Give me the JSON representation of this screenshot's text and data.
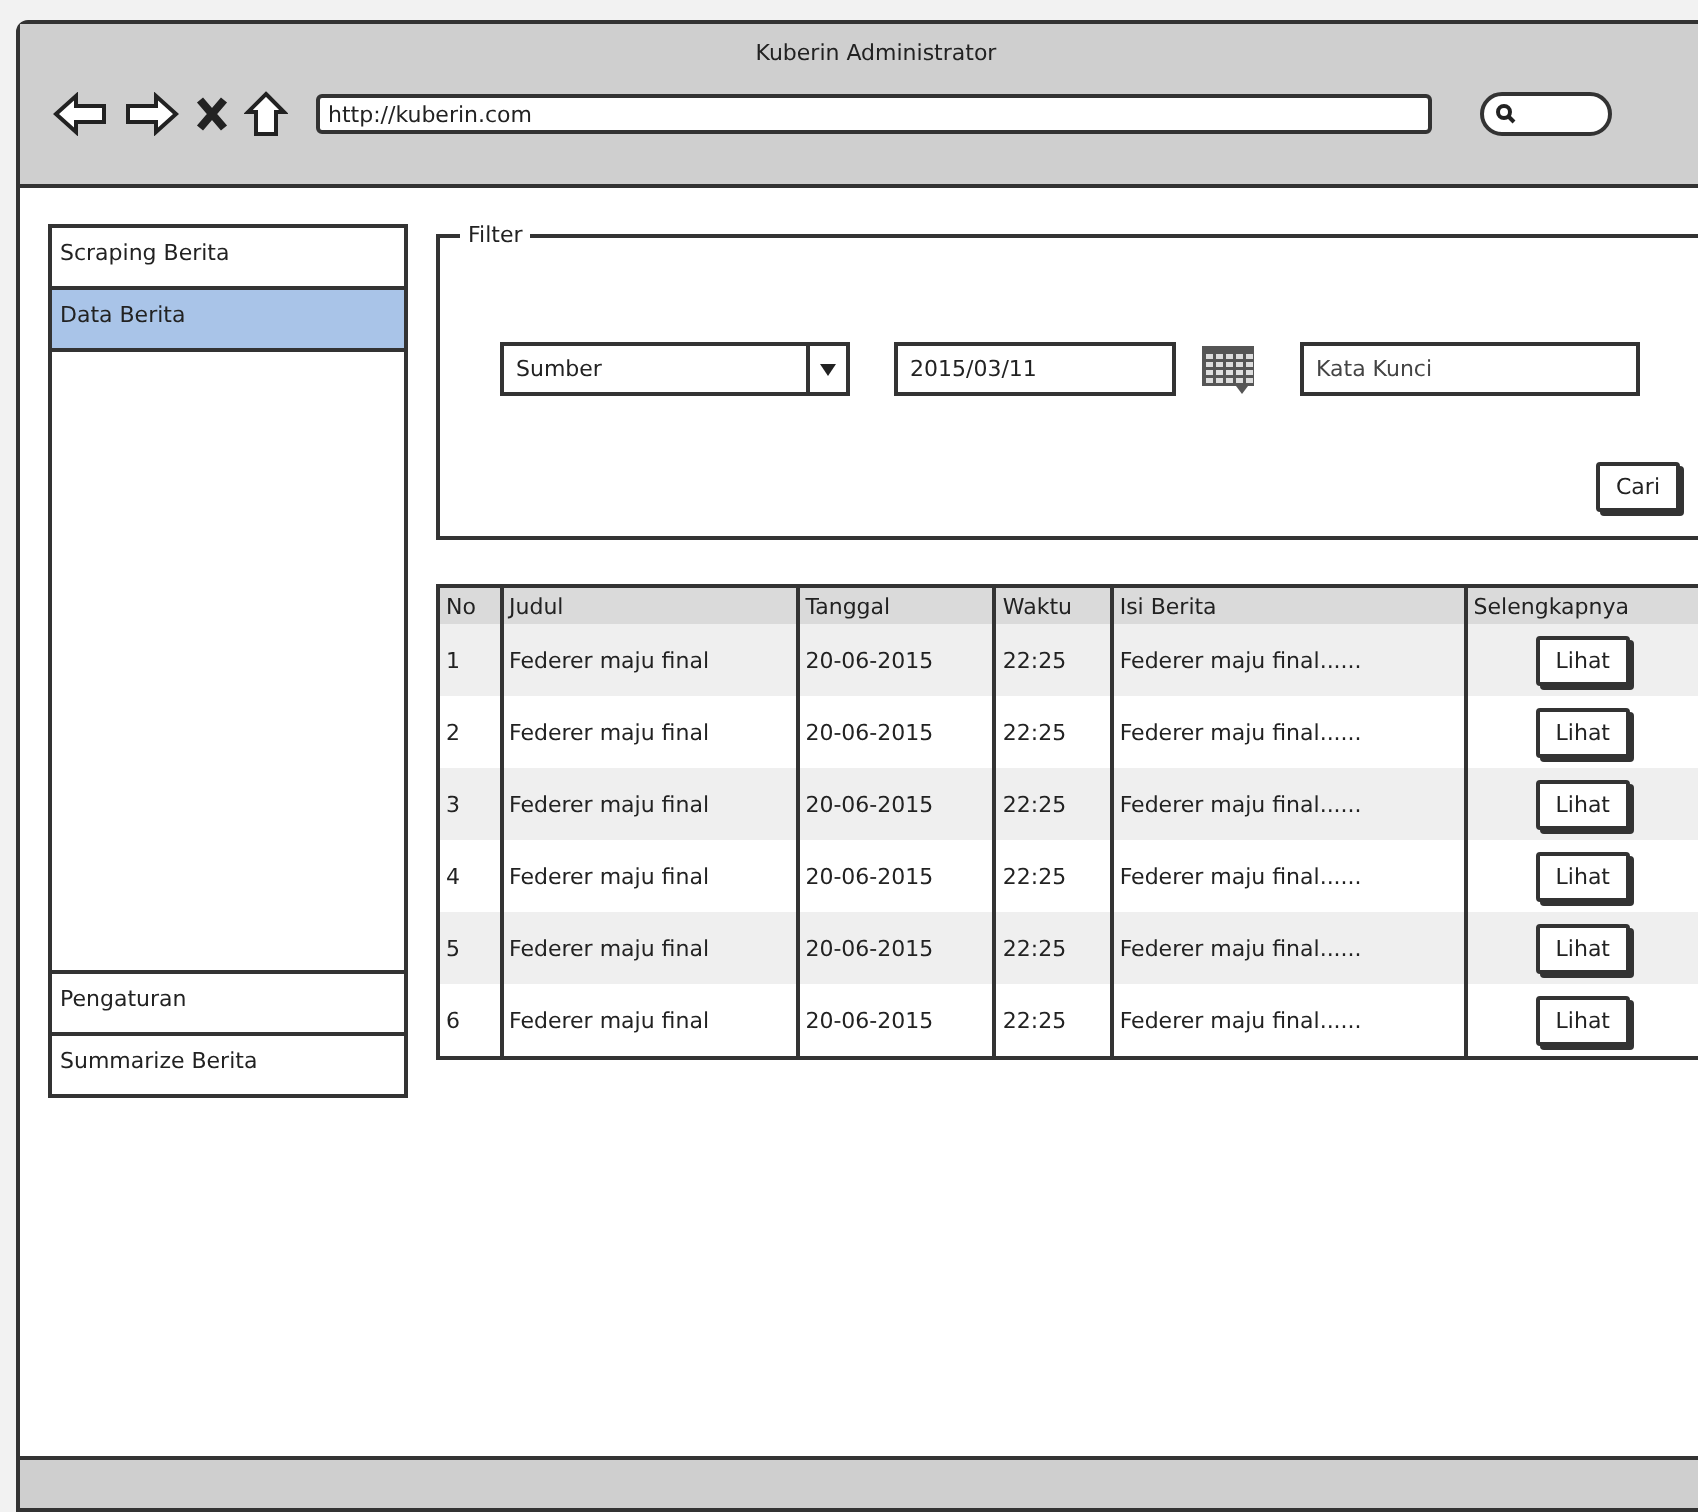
{
  "window": {
    "title": "Kuberin Administrator",
    "url": "http://kuberin.com"
  },
  "sidebar": {
    "top_items": [
      {
        "label": "Scraping Berita",
        "selected": false
      },
      {
        "label": "Data Berita",
        "selected": true
      }
    ],
    "bottom_items": [
      {
        "label": "Pengaturan",
        "selected": false
      },
      {
        "label": "Summarize Berita",
        "selected": false
      }
    ]
  },
  "filter": {
    "title": "Filter",
    "source": {
      "value": "Sumber"
    },
    "date": {
      "value": "2015/03/11"
    },
    "keyword": {
      "placeholder": "Kata Kunci"
    },
    "button": "Cari"
  },
  "table": {
    "columns": [
      "No",
      "Judul",
      "Tanggal",
      "Waktu",
      "Isi Berita",
      "Selengkapnya"
    ],
    "rows": [
      {
        "no": "1",
        "title": "Federer maju final",
        "date": "20-06-2015",
        "time": "22:25",
        "content": "Federer maju final......",
        "action": "Lihat"
      },
      {
        "no": "2",
        "title": "Federer maju final",
        "date": "20-06-2015",
        "time": "22:25",
        "content": "Federer maju final......",
        "action": "Lihat"
      },
      {
        "no": "3",
        "title": "Federer maju final",
        "date": "20-06-2015",
        "time": "22:25",
        "content": "Federer maju final......",
        "action": "Lihat"
      },
      {
        "no": "4",
        "title": "Federer maju final",
        "date": "20-06-2015",
        "time": "22:25",
        "content": "Federer maju final......",
        "action": "Lihat"
      },
      {
        "no": "5",
        "title": "Federer maju final",
        "date": "20-06-2015",
        "time": "22:25",
        "content": "Federer maju final......",
        "action": "Lihat"
      },
      {
        "no": "6",
        "title": "Federer maju final",
        "date": "20-06-2015",
        "time": "22:25",
        "content": "Federer maju final......",
        "action": "Lihat"
      }
    ]
  }
}
